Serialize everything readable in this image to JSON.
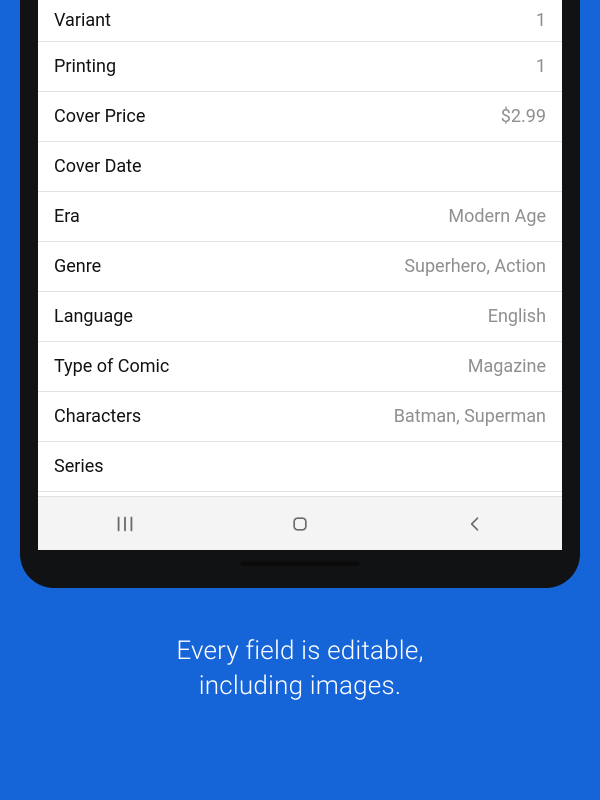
{
  "fields": [
    {
      "label": "Variant",
      "value": "1"
    },
    {
      "label": "Printing",
      "value": "1"
    },
    {
      "label": "Cover Price",
      "value": "$2.99"
    },
    {
      "label": "Cover Date",
      "value": ""
    },
    {
      "label": "Era",
      "value": "Modern Age"
    },
    {
      "label": "Genre",
      "value": "Superhero, Action"
    },
    {
      "label": "Language",
      "value": "English"
    },
    {
      "label": "Type of Comic",
      "value": "Magazine"
    },
    {
      "label": "Characters",
      "value": "Batman, Superman"
    },
    {
      "label": "Series",
      "value": ""
    }
  ],
  "caption": {
    "line1": "Every field is editable,",
    "line2": "including images."
  }
}
